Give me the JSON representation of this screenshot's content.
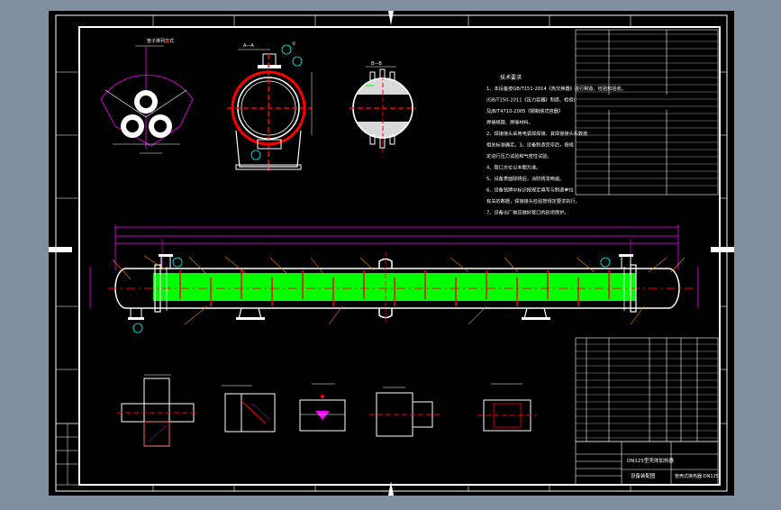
{
  "colors": {
    "background": "#7f8fa0",
    "sheet": "#000000",
    "frame": "#ffffff",
    "accent_green": "#00ff00",
    "accent_red": "#ff0000",
    "accent_magenta": "#ff00ff",
    "accent_cyan": "#00ffff",
    "accent_orange": "#ff8000",
    "accent_yellow": "#ffff00"
  },
  "drawing": {
    "title_block": {
      "drawing_title_line1": "DN125型壳体加热器",
      "drawing_title_line2": "设备装配图",
      "drawing_number": "管壳式换热器-DN125"
    },
    "tech_requirements": {
      "heading": "技术要求",
      "lines": [
        "1、本设备按GB/T151-2014《热交换器》进行制造、检验和验收。",
        "(GB/T150-2011《压力容器》制造、检验)",
        "及JB/T4710-2005《钢制塔式容器》",
        "焊接规程、焊接材料。",
        "2、焊接接头采用电弧焊焊接，其焊接接头系数按",
        "相关标准确定。3、设备制造完毕后，按规",
        "定进行压力试验和气密性试验。",
        "4、管口方位以本图为准。",
        "5、设备表面除锈后，涂防锈漆两遍。",
        "6、设备铭牌中标识按规定填写与制造单位",
        "有关的数据，焊接接头检验按规定要求执行。",
        "7、设备出厂前应做好管口的封闭保护。"
      ]
    },
    "section_markers": [
      "A",
      "B",
      "A",
      "B"
    ]
  },
  "icons": {
    "tube_layout": "tube-layout-detail-icon",
    "end_view": "end-view-icon",
    "side_view": "side-view-icon",
    "main_view": "main-elevation-icon",
    "details": "weld-detail-icon"
  }
}
